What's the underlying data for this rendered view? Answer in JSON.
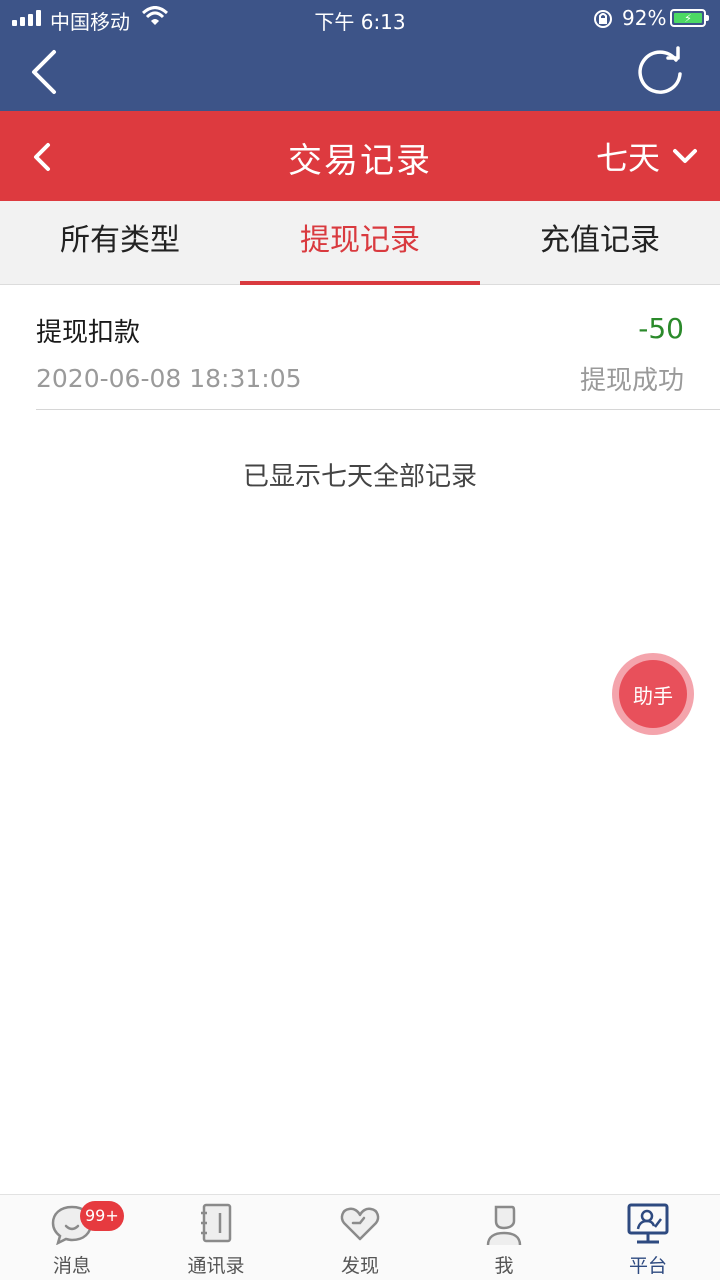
{
  "status_bar": {
    "carrier": "中国移动",
    "time": "下午 6:13",
    "battery": "92%"
  },
  "header": {
    "title": "交易记录",
    "period": "七天"
  },
  "tabs": [
    {
      "label": "所有类型",
      "active": false
    },
    {
      "label": "提现记录",
      "active": true
    },
    {
      "label": "充值记录",
      "active": false
    }
  ],
  "records": [
    {
      "title": "提现扣款",
      "datetime": "2020-06-08 18:31:05",
      "amount": "-50",
      "status": "提现成功"
    }
  ],
  "footer_note": "已显示七天全部记录",
  "assistant_label": "助手",
  "tabbar": {
    "items": [
      {
        "label": "消息",
        "icon": "chat-bubble-icon",
        "badge": "99+"
      },
      {
        "label": "通讯录",
        "icon": "contacts-book-icon"
      },
      {
        "label": "发现",
        "icon": "heart-icon"
      },
      {
        "label": "我",
        "icon": "person-icon"
      },
      {
        "label": "平台",
        "icon": "platform-monitor-icon",
        "active": true
      }
    ]
  },
  "colors": {
    "nav_blue": "#3d5488",
    "header_red": "#dd3a3f",
    "active_tab": "#d93a3f",
    "amount_green": "#2b8a2b",
    "tabbar_active": "#2e4a80"
  }
}
